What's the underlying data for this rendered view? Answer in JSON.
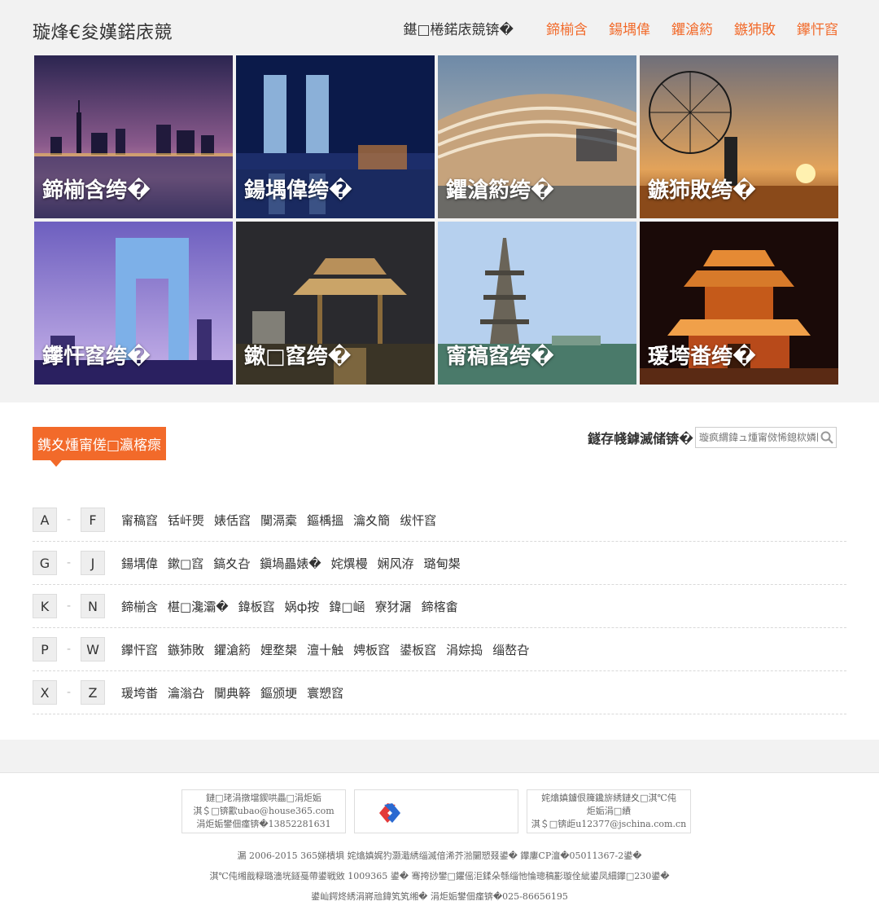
{
  "header": {
    "site_title": "璇烽€夋嫨鍩庡競",
    "nav_label": "鍖□棬鍩庡競锛�",
    "nav_links": [
      "鍗椾含",
      "鍚堣偉",
      "鑺滄箹",
      "鏃犻敗",
      "鑻忓窞"
    ]
  },
  "tiles": [
    {
      "caption": "鍗椾含绔�"
    },
    {
      "caption": "鍚堣偉绔�"
    },
    {
      "caption": "鑺滄箹绔�"
    },
    {
      "caption": "鏃犻敗绔�"
    },
    {
      "caption": "鑻忓窞绔�"
    },
    {
      "caption": "鏉□窞绔�"
    },
    {
      "caption": "甯稿窞绔�"
    },
    {
      "caption": "瑗垮畨绔�"
    }
  ],
  "section": {
    "title": "鎸夊煄甯傞□瀛楁瘝",
    "search_label": "鐩存帴鎼滅储锛�",
    "search_placeholder": "璇疯緭鍏ュ煄甯傚悕鎴栨嫾闊"
  },
  "alpha_rows": [
    {
      "from": "A",
      "to": "F",
      "cities": [
        "甯稿窞",
        "铦屽煚",
        "婊佸窞",
        "闃滆槖",
        "鏂楀搵",
        "瀹夊簡",
        "绂忓窞"
      ]
    },
    {
      "from": "G",
      "to": "J",
      "cities": [
        "鍚堣偉",
        "鏉□窞",
        "鎬夊叴",
        "鎭堝畾婊�",
        "姹熼槾",
        "娴风洊",
        "璐甸槼"
      ]
    },
    {
      "from": "K",
      "to": "N",
      "cities": [
        "鍗椾含",
        "椹□瀺灞�",
        "鍏板窞",
        "娲ф按",
        "鍏□崡",
        "寮犲潳",
        "鍗楁畬"
      ]
    },
    {
      "from": "P",
      "to": "W",
      "cities": [
        "鑻忓窞",
        "鏃犻敗",
        "鑺滄箹",
        "娌堥槼",
        "澶十触",
        "娉板窞",
        "鍙板窞",
        "涓婃捣",
        "缁嶅叴"
      ]
    },
    {
      "from": "X",
      "to": "Z",
      "cities": [
        "瑗垮畨",
        "瀹滃叴",
        "闃典簳",
        "鏂颁埂",
        "寰愬窞"
      ]
    }
  ],
  "partners": {
    "left_lines": [
      "鏈□珯涓撴壋鍥哄畾□涓炬姤",
      "淇＄□锛歠ubao@house365.com",
      "涓炬姤鐢佃瘽锛�13852281631"
    ],
    "right_lines": [
      "姹熻嫃鐪佷簰鑱旂綉鏈夊□淇℃伅",
      "炬姤涓□績",
      "淇＄□锛歫u12377@jschina.com.cn"
    ]
  },
  "footer": {
    "line1": "漏 2006-2015 365娣樻埧 姹熻嫃娓犳灏濈綉缁滅偣浠芥湁闄愬叕鍙� 鑻廔CP澶�05011367-2鍙�",
    "line2": "淇℃伅缃戠粶璐濇垙鐩戞帶鍙戦敓 1009365 鍙� 骞挎挱鐢□鑺傜洰鍒朵綔缁忚惀璁稿彲璇佺紪鍙凤細鑻□230鍙�",
    "line3": "鍙屾鍔炵綉涓嶈兘鍏笂笂缃� 涓炬姤鐢佃瘽锛�025-86656195"
  },
  "colors": {
    "accent": "#f26a2a",
    "band": "#f2f2f2"
  }
}
